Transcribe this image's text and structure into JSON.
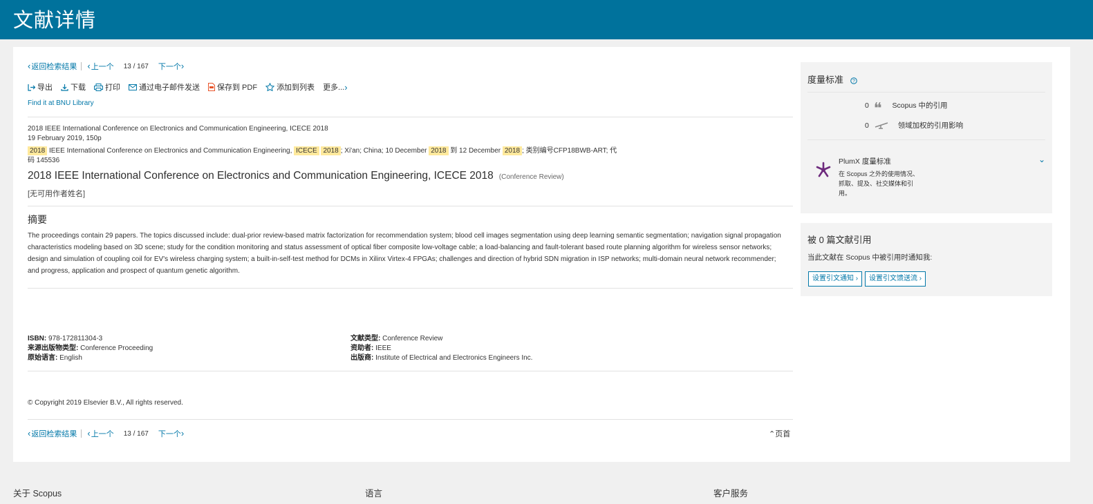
{
  "header": {
    "title": "文献详情"
  },
  "nav": {
    "back": "返回检索结果",
    "prev": "上一个",
    "current": "13",
    "slash": "/",
    "total": "167",
    "next": "下一个"
  },
  "toolbar": {
    "export": "导出",
    "download": "下载",
    "print": "打印",
    "email": "通过电子邮件发送",
    "save_pdf": "保存到 PDF",
    "add_list": "添加到列表",
    "more": "更多..."
  },
  "find_it": "Find it at BNU Library",
  "source": {
    "line1": "2018 IEEE International Conference on Electronics and Communication Engineering, ICECE 2018",
    "line2": "19 February 2019, 150p",
    "hl1": "2018",
    "text1": " IEEE International Conference on Electronics and Communication Engineering, ",
    "hl2": "ICECE",
    "hl3": "2018",
    "text2": "; Xi'an; China; 10 December ",
    "hl4": "2018",
    "text3": " 到 12 December ",
    "hl5": "2018",
    "text4": "; 类别编号CFP18BWB-ART; 代",
    "line4": "码 145536"
  },
  "document": {
    "title": "2018 IEEE International Conference on Electronics and Communication Engineering, ICECE 2018",
    "type": "(Conference Review)",
    "no_author": "[无可用作者姓名]"
  },
  "abstract": {
    "heading": "摘要",
    "text": "The proceedings contain 29 papers. The topics discussed include: dual-prior review-based matrix factorization for recommendation system; blood cell images segmentation using deep learning semantic segmentation; navigation signal propagation characteristics modeling based on 3D scene; study for the condition monitoring and status assessment of optical fiber composite low-voltage cable; a load-balancing and fault-tolerant based route planning algorithm for wireless sensor networks; design and simulation of coupling coil for EV's wireless charging system; a built-in-self-test method for DCMs in Xilinx Virtex-4 FPGAs; challenges and direction of hybrid SDN migration in ISP networks; multi-domain neural network recommender; and progress, application and prospect of quantum genetic algorithm."
  },
  "meta": {
    "isbn_label": "ISBN:",
    "isbn": "978-172811304-3",
    "source_type_label": "来源出版物类型:",
    "source_type": "Conference Proceeding",
    "language_label": "原始语言:",
    "language": "English",
    "doc_type_label": "文献类型:",
    "doc_type": "Conference Review",
    "sponsor_label": "资助者:",
    "sponsor": "IEEE",
    "publisher_label": "出版商:",
    "publisher": "Institute of Electrical and Electronics Engineers Inc."
  },
  "copyright": "© Copyright 2019 Elsevier B.V., All rights reserved.",
  "back_to_top": "页首",
  "metrics": {
    "heading": "度量标准",
    "scopus_count": "0",
    "scopus_label": "Scopus 中的引用",
    "fwci_count": "0",
    "fwci_label": "领域加权的引用影响",
    "plumx_title": "PlumX 度量标准",
    "plumx_desc": "在 Scopus 之外的使用情况、抓取、提及、社交媒体和引用。"
  },
  "cited_by": {
    "heading": "被 0 篇文献引用",
    "notify": "当此文献在 Scopus 中被引用时通知我:",
    "alert_btn": "设置引文通知",
    "feed_btn": "设置引文馈送流"
  },
  "footer": {
    "about": "关于 Scopus",
    "language": "语言",
    "service": "客户服务"
  },
  "colors": {
    "brand": "#00729c",
    "link": "#0077a8",
    "highlight": "#ffe99c"
  }
}
